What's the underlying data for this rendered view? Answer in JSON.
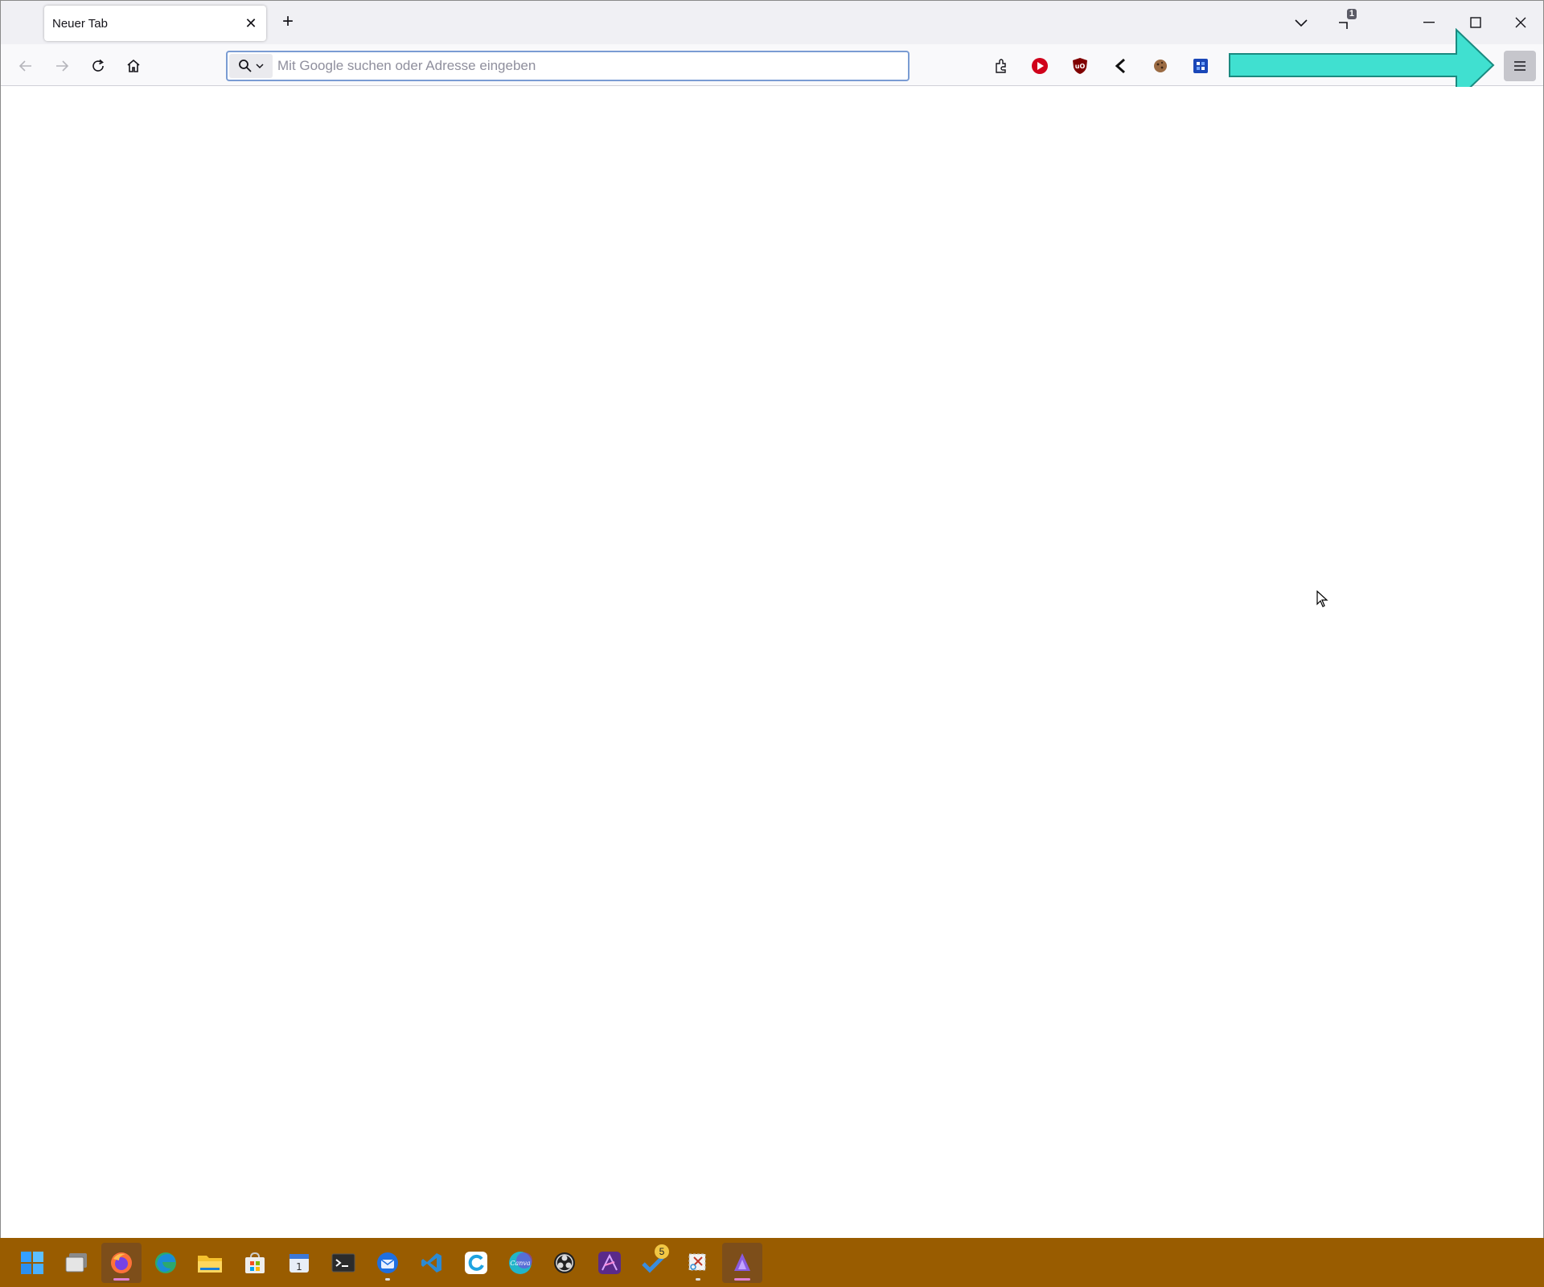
{
  "browser": {
    "tab": {
      "title": "Neuer Tab"
    },
    "tab_overview_count": "1",
    "urlbar": {
      "placeholder": "Mit Google suchen oder Adresse eingeben",
      "value": ""
    }
  },
  "colors": {
    "tabbar_bg": "#f0f0f4",
    "navbar_bg": "#f9f9fb",
    "urlbar_border": "#7a9cd3",
    "annotation_arrow": "#40e0d0",
    "taskbar_bg": "#995c00"
  },
  "extensions": [
    "extensions-puzzle-icon",
    "youtube-play-icon",
    "ublock-origin-icon",
    "back-arrow-extension-icon",
    "cookie-icon",
    "blue-grid-extension-icon"
  ],
  "taskbar": {
    "items": [
      {
        "name": "windows-start-icon"
      },
      {
        "name": "task-view-icon"
      },
      {
        "name": "firefox-icon",
        "active": true
      },
      {
        "name": "edge-icon"
      },
      {
        "name": "file-explorer-icon"
      },
      {
        "name": "microsoft-store-icon"
      },
      {
        "name": "calendar-icon"
      },
      {
        "name": "terminal-icon"
      },
      {
        "name": "thunderbird-icon"
      },
      {
        "name": "vscode-icon"
      },
      {
        "name": "sync-app-icon"
      },
      {
        "name": "canva-icon",
        "label": "Canva"
      },
      {
        "name": "obs-icon"
      },
      {
        "name": "affinity-photo-icon"
      },
      {
        "name": "todo-icon",
        "badge": "5"
      },
      {
        "name": "snipping-tool-icon"
      },
      {
        "name": "purple-app-icon",
        "active": true
      }
    ]
  }
}
